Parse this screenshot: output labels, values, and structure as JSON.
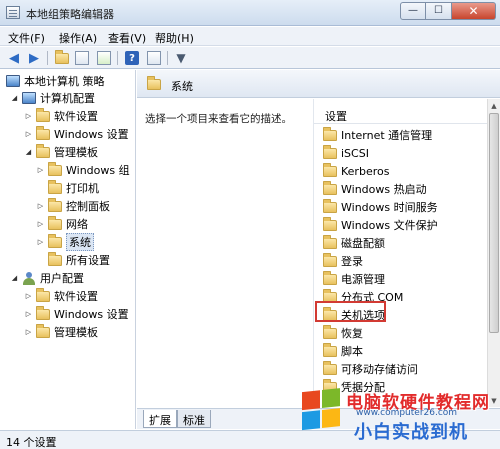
{
  "window": {
    "title": "本地组策略编辑器",
    "min_symbol": "—",
    "max_symbol": "☐",
    "close_symbol": "✕"
  },
  "menu": [
    "文件(F)",
    "操作(A)",
    "查看(V)",
    "帮助(H)"
  ],
  "toolbar_icons": [
    "back-arrow-icon",
    "forward-arrow-icon",
    "up-folder-icon",
    "show-hide-tree-icon",
    "export-list-icon",
    "help-icon",
    "properties-icon",
    "filter-icon"
  ],
  "tree": {
    "root": "本地计算机 策略",
    "computer_config": "计算机配置",
    "software_settings_1": "软件设置",
    "windows_settings_1": "Windows 设置",
    "admin_templates_1": "管理模板",
    "windows_components": "Windows 组",
    "printers": "打印机",
    "control_panel": "控制面板",
    "network": "网络",
    "system": "系统",
    "all_settings": "所有设置",
    "user_config": "用户配置",
    "software_settings_2": "软件设置",
    "windows_settings_2": "Windows 设置",
    "admin_templates_2": "管理模板"
  },
  "header": {
    "title": "系统"
  },
  "description": "选择一个项目来查看它的描述。",
  "list": {
    "column_header": "设置",
    "items": [
      "Internet 通信管理",
      "iSCSI",
      "Kerberos",
      "Windows 热启动",
      "Windows 时间服务",
      "Windows 文件保护",
      "磁盘配额",
      "登录",
      "电源管理",
      "分布式 COM",
      "关机选项",
      "恢复",
      "脚本",
      "可移动存储访问",
      "凭据分配"
    ],
    "highlighted_item": "关机选项"
  },
  "tabs": [
    "扩展",
    "标准"
  ],
  "status": "14 个设置",
  "watermark": {
    "line1": "电脑软硬件教程网",
    "url": "www.computer26.com",
    "line2": "小白实战到机"
  },
  "colors": {
    "accent_blue": "#2d6bc4",
    "highlight_red": "#d23a33",
    "folder_yellow": "#e8c15e"
  }
}
